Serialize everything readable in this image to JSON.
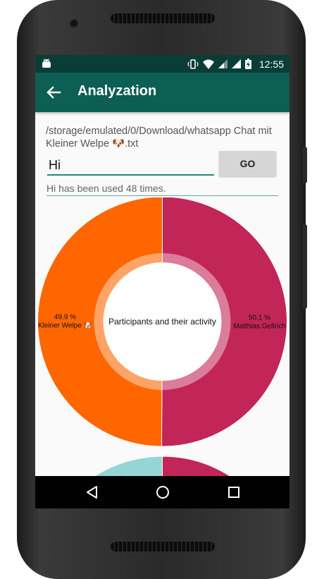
{
  "status_bar": {
    "time": "12:55"
  },
  "app_bar": {
    "title": "Analyzation"
  },
  "file_path": "/storage/emulated/0/Download/whatsapp Chat mit Kleiner Welpe 🐶.txt",
  "search": {
    "value": "Hi",
    "button_label": "GO"
  },
  "result_text": "Hi has been used 48 times.",
  "chart_data": {
    "type": "pie",
    "title": "Participants and their activity",
    "labels": [
      "Matthias Gellrich",
      "Kleiner Welpe 🐶"
    ],
    "values": [
      50.1,
      49.9
    ],
    "value_labels": [
      "50.1 %",
      "49.9 %"
    ],
    "colors": [
      "#c22558",
      "#ff6600"
    ],
    "hole": true
  },
  "partial_chart": {
    "colors": [
      "#c22558",
      "#96d5d6",
      "#c8eeee"
    ]
  },
  "nav": {
    "icons": [
      "back-triangle-icon",
      "home-circle-icon",
      "recents-square-icon"
    ]
  }
}
